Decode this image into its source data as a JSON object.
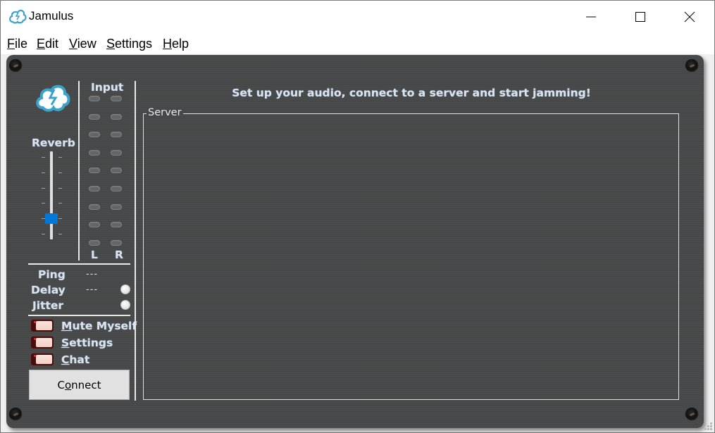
{
  "window": {
    "title": "Jamulus",
    "controls": {
      "minimize": "minimize",
      "maximize": "maximize",
      "close": "close"
    }
  },
  "menu": [
    {
      "label": "File",
      "mnemonic": "F",
      "rest": "ile"
    },
    {
      "label": "Edit",
      "mnemonic": "E",
      "rest": "dit"
    },
    {
      "label": "View",
      "mnemonic": "V",
      "rest": "iew"
    },
    {
      "label": "Settings",
      "mnemonic": "S",
      "rest": "ettings"
    },
    {
      "label": "Help",
      "mnemonic": "H",
      "rest": "elp"
    }
  ],
  "left_panel": {
    "reverb_label": "Reverb",
    "reverb_level_fraction": 0.2,
    "input_label": "Input",
    "channel_left": "L",
    "channel_right": "R",
    "led_count_per_channel": 9,
    "stats": {
      "ping_label": "Ping",
      "ping_value": "---",
      "delay_label": "Delay",
      "delay_value": "---",
      "jitter_label": "Jitter"
    },
    "toggles": [
      {
        "label": "Mute Myself",
        "mnemonic": "M",
        "rest": "ute Myself",
        "on": false
      },
      {
        "label": "Settings",
        "mnemonic": "S",
        "rest": "ettings",
        "on": false
      },
      {
        "label": "Chat",
        "mnemonic": "C",
        "rest": "hat",
        "on": false
      }
    ],
    "connect_button": {
      "label": "Connect",
      "pre": "C",
      "mnemonic": "o",
      "rest": "nnect"
    }
  },
  "main": {
    "headline": "Set up your audio, connect to a server and start jamming!",
    "server_group_title": "Server"
  },
  "colors": {
    "panel_bg": "#474849",
    "label_text": "#d8e3ef",
    "slider_thumb": "#0078d7",
    "logo_blue": "#3ba3c9"
  }
}
